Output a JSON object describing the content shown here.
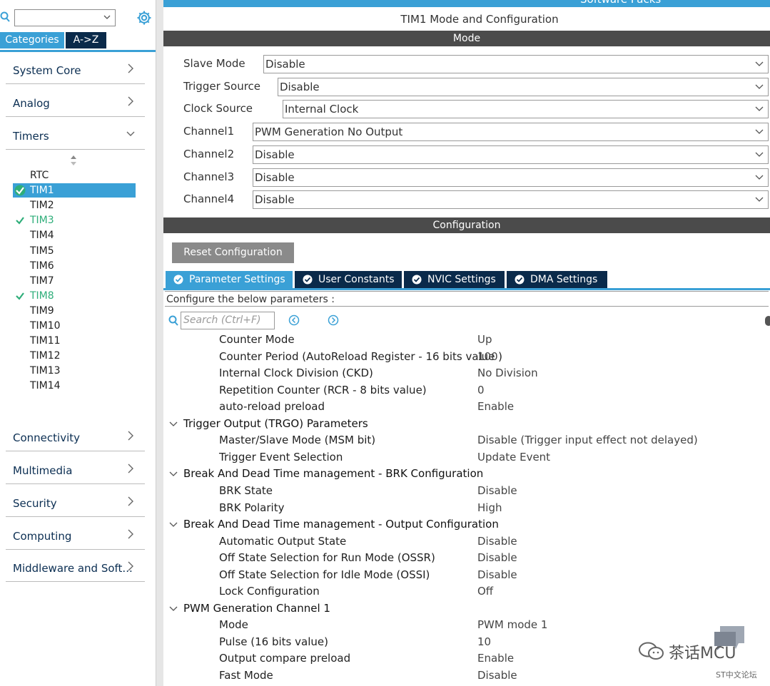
{
  "sidebar": {
    "search": {
      "value": ""
    },
    "tabs": [
      "Categories",
      "A->Z"
    ],
    "categories_top": [
      "System Core",
      "Analog",
      "Timers"
    ],
    "timers": [
      {
        "label": "RTC",
        "state": "none"
      },
      {
        "label": "TIM1",
        "state": "selected"
      },
      {
        "label": "TIM2",
        "state": "none"
      },
      {
        "label": "TIM3",
        "state": "configured"
      },
      {
        "label": "TIM4",
        "state": "none"
      },
      {
        "label": "TIM5",
        "state": "none"
      },
      {
        "label": "TIM6",
        "state": "none"
      },
      {
        "label": "TIM7",
        "state": "none"
      },
      {
        "label": "TIM8",
        "state": "configured"
      },
      {
        "label": "TIM9",
        "state": "none"
      },
      {
        "label": "TIM10",
        "state": "none"
      },
      {
        "label": "TIM11",
        "state": "none"
      },
      {
        "label": "TIM12",
        "state": "none"
      },
      {
        "label": "TIM13",
        "state": "none"
      },
      {
        "label": "TIM14",
        "state": "none"
      }
    ],
    "categories_bottom": [
      "Connectivity",
      "Multimedia",
      "Security",
      "Computing",
      "Middleware and Soft..."
    ]
  },
  "header": {
    "strip_text": "Software Packs",
    "title": "TIM1 Mode and Configuration"
  },
  "mode": {
    "section_title": "Mode",
    "rows": [
      {
        "label": "Slave Mode",
        "value": "Disable"
      },
      {
        "label": "Trigger Source",
        "value": "Disable"
      },
      {
        "label": "Clock Source",
        "value": "Internal Clock"
      },
      {
        "label": "Channel1",
        "value": "PWM Generation No Output"
      },
      {
        "label": "Channel2",
        "value": "Disable"
      },
      {
        "label": "Channel3",
        "value": "Disable"
      },
      {
        "label": "Channel4",
        "value": "Disable"
      }
    ]
  },
  "configuration": {
    "section_title": "Configuration",
    "reset_label": "Reset Configuration",
    "tabs": [
      "Parameter Settings",
      "User Constants",
      "NVIC Settings",
      "DMA Settings"
    ],
    "instruction": "Configure the below parameters :",
    "search_placeholder": "Search (Ctrl+F)",
    "params": [
      {
        "kind": "param",
        "name": "Counter Mode",
        "value": "Up"
      },
      {
        "kind": "param",
        "name": "Counter Period (AutoReload Register - 16 bits value )",
        "value": "100"
      },
      {
        "kind": "param",
        "name": "Internal Clock Division (CKD)",
        "value": "No Division"
      },
      {
        "kind": "param",
        "name": "Repetition Counter (RCR - 8 bits value)",
        "value": "0"
      },
      {
        "kind": "param",
        "name": "auto-reload preload",
        "value": "Enable"
      },
      {
        "kind": "group",
        "name": "Trigger Output (TRGO) Parameters"
      },
      {
        "kind": "param",
        "name": "Master/Slave Mode (MSM bit)",
        "value": "Disable (Trigger input effect not delayed)"
      },
      {
        "kind": "param",
        "name": "Trigger Event Selection",
        "value": "Update Event"
      },
      {
        "kind": "group",
        "name": "Break And Dead Time management - BRK Configuration"
      },
      {
        "kind": "param",
        "name": "BRK State",
        "value": "Disable"
      },
      {
        "kind": "param",
        "name": "BRK Polarity",
        "value": "High"
      },
      {
        "kind": "group",
        "name": "Break And Dead Time management - Output Configuration"
      },
      {
        "kind": "param",
        "name": "Automatic Output State",
        "value": "Disable"
      },
      {
        "kind": "param",
        "name": "Off State Selection for Run Mode (OSSR)",
        "value": "Disable"
      },
      {
        "kind": "param",
        "name": "Off State Selection for Idle Mode (OSSI)",
        "value": "Disable"
      },
      {
        "kind": "param",
        "name": "Lock Configuration",
        "value": "Off"
      },
      {
        "kind": "group",
        "name": "PWM Generation Channel 1"
      },
      {
        "kind": "param",
        "name": "Mode",
        "value": "PWM mode 1"
      },
      {
        "kind": "param",
        "name": "Pulse (16 bits value)",
        "value": "10"
      },
      {
        "kind": "param",
        "name": "Output compare preload",
        "value": "Enable"
      },
      {
        "kind": "param",
        "name": "Fast Mode",
        "value": "Disable"
      }
    ]
  },
  "watermark": {
    "text": "茶话MCU",
    "sub": "ST中文论坛"
  },
  "colors": {
    "accent": "#3aa0d6",
    "navy": "#0a2a4a",
    "section": "#4b4b4b",
    "configured": "#2fae7a"
  }
}
